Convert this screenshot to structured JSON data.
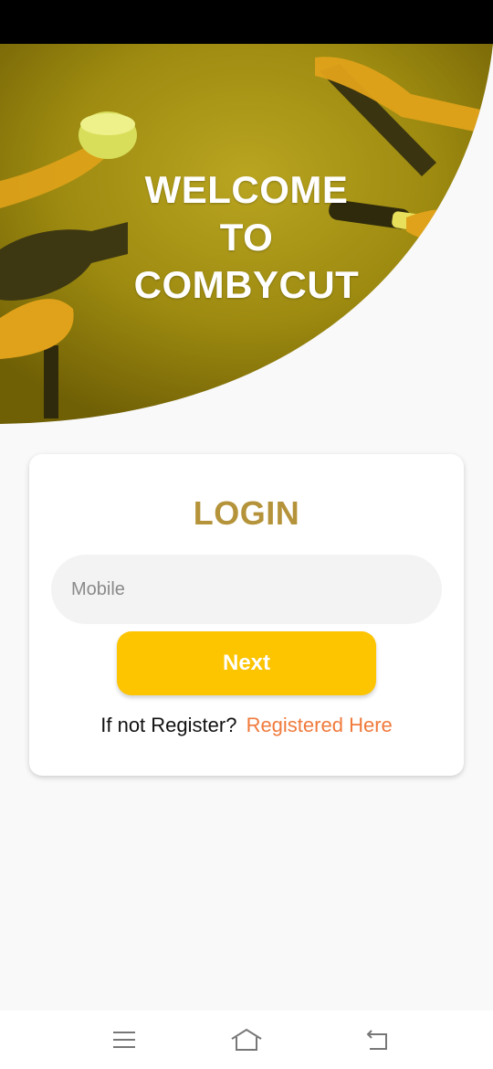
{
  "hero": {
    "title_line1": "WELCOME",
    "title_line2": "TO",
    "title_line3": "COMBYCUT",
    "accent_color": "#c9a800"
  },
  "login": {
    "title": "LOGIN",
    "mobile_placeholder": "Mobile",
    "mobile_value": "",
    "next_label": "Next",
    "register_prompt": "If not Register?",
    "register_link": "Registered Here",
    "title_color": "#b5933a",
    "button_color": "#fdc400",
    "link_color": "#f07a3c"
  },
  "nav": {
    "menu_icon": "menu-icon",
    "home_icon": "home-icon",
    "back_icon": "back-icon"
  }
}
